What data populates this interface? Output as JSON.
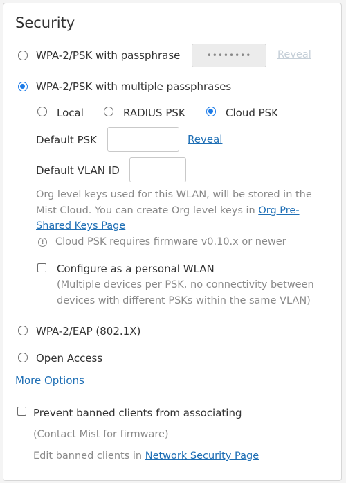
{
  "section": {
    "title": "Security"
  },
  "security_options": {
    "wpa2_psk": {
      "label": "WPA-2/PSK with passphrase",
      "masked_value": "••••••••",
      "reveal_label": "Reveal"
    },
    "wpa2_multi": {
      "label": "WPA-2/PSK with multiple passphrases",
      "sources": {
        "local": "Local",
        "radius": "RADIUS PSK",
        "cloud": "Cloud PSK",
        "selected": "Cloud PSK"
      },
      "default_psk": {
        "label": "Default PSK",
        "value": "",
        "reveal_label": "Reveal"
      },
      "default_vlan": {
        "label": "Default VLAN ID",
        "value": ""
      },
      "description_line1": "Org level keys used for this WLAN, will be stored in the",
      "description_line2": "Mist Cloud. You can create Org level keys in",
      "org_link_part1": "Org Pre-",
      "org_link_part2": "Shared Keys Page",
      "firmware_note": "Cloud PSK requires firmware v0.10.x or newer",
      "personal_wlan": {
        "label": "Configure as a personal WLAN",
        "help_line1": "(Multiple devices per PSK, no connectivity between",
        "help_line2": "devices with different PSKs within the same VLAN)",
        "checked": false
      }
    },
    "wpa2_eap": {
      "label": "WPA-2/EAP (802.1X)"
    },
    "open": {
      "label": "Open Access"
    },
    "selected": "WPA-2/PSK with multiple passphrases"
  },
  "more_options_label": "More Options",
  "banned": {
    "label": "Prevent banned clients from associating",
    "checked": false,
    "note": "(Contact Mist for firmware)",
    "edit_prefix": "Edit banned clients in",
    "edit_link": "Network Security Page"
  },
  "colors": {
    "accent": "#1c7be8",
    "link": "#1f6fb5"
  }
}
